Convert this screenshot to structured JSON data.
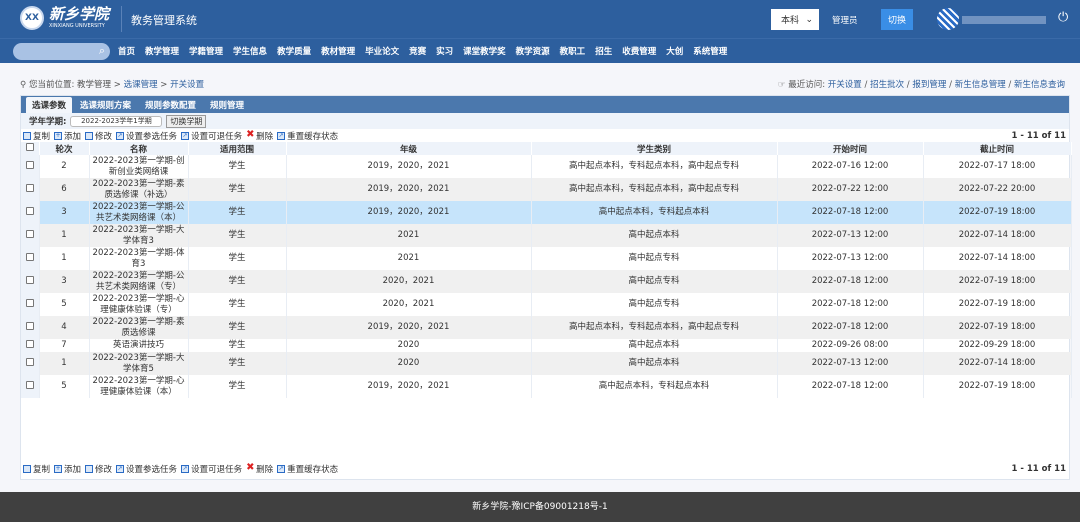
{
  "header": {
    "logo_cn": "新乡学院",
    "logo_en": "XINXIANG UNIVERSITY",
    "system_title": "教务管理系统",
    "level_select": "本科",
    "role": "管理员",
    "switch_button": "切换"
  },
  "nav": {
    "items": [
      "首页",
      "教学管理",
      "学籍管理",
      "学生信息",
      "教学质量",
      "教材管理",
      "毕业论文",
      "竞赛",
      "实习",
      "课堂教学奖",
      "教学资源",
      "教职工",
      "招生",
      "收费管理",
      "大创",
      "系统管理"
    ]
  },
  "breadcrumb": {
    "label": "您当前位置:",
    "items": [
      "教学管理",
      "选课管理",
      "开关设置"
    ]
  },
  "recent": {
    "label": "最近访问:",
    "items": [
      "开关设置",
      "招生批次",
      "报到管理",
      "新生信息管理",
      "新生信息查询"
    ]
  },
  "tabs": [
    "选课参数",
    "选课规则方案",
    "规则参数配置",
    "规则管理"
  ],
  "semester": {
    "label": "学年学期:",
    "value": "2022-2023学年1学期",
    "button": "切换学期"
  },
  "toolbar": {
    "copy": "复制",
    "add": "添加",
    "edit": "修改",
    "set_select": "设置参选任务",
    "set_drop": "设置可退任务",
    "delete": "删除",
    "reset": "重置缓存状态"
  },
  "pagination": "1 - 11 of 11",
  "table": {
    "headers": [
      "轮次",
      "名称",
      "适用范围",
      "年级",
      "学生类别",
      "开始时间",
      "截止时间"
    ],
    "rows": [
      [
        "2",
        "2022-2023第一学期-创新创业类网络课",
        "学生",
        "2019，2020，2021",
        "高中起点本科，专科起点本科，高中起点专科",
        "2022-07-16 12:00",
        "2022-07-17 18:00"
      ],
      [
        "6",
        "2022-2023第一学期-素质选修课（补选）",
        "学生",
        "2019，2020，2021",
        "高中起点本科，专科起点本科，高中起点专科",
        "2022-07-22 12:00",
        "2022-07-22 20:00"
      ],
      [
        "3",
        "2022-2023第一学期-公共艺术类网络课（本）",
        "学生",
        "2019，2020，2021",
        "高中起点本科，专科起点本科",
        "2022-07-18 12:00",
        "2022-07-19 18:00"
      ],
      [
        "1",
        "2022-2023第一学期-大学体育3",
        "学生",
        "2021",
        "高中起点本科",
        "2022-07-13 12:00",
        "2022-07-14 18:00"
      ],
      [
        "1",
        "2022-2023第一学期-体育3",
        "学生",
        "2021",
        "高中起点专科",
        "2022-07-13 12:00",
        "2022-07-14 18:00"
      ],
      [
        "3",
        "2022-2023第一学期-公共艺术类网络课（专）",
        "学生",
        "2020，2021",
        "高中起点专科",
        "2022-07-18 12:00",
        "2022-07-19 18:00"
      ],
      [
        "5",
        "2022-2023第一学期-心理健康体验课（专）",
        "学生",
        "2020，2021",
        "高中起点专科",
        "2022-07-18 12:00",
        "2022-07-19 18:00"
      ],
      [
        "4",
        "2022-2023第一学期-素质选修课",
        "学生",
        "2019，2020，2021",
        "高中起点本科，专科起点本科，高中起点专科",
        "2022-07-18 12:00",
        "2022-07-19 18:00"
      ],
      [
        "7",
        "英语演讲技巧",
        "学生",
        "2020",
        "高中起点本科",
        "2022-09-26 08:00",
        "2022-09-29 18:00"
      ],
      [
        "1",
        "2022-2023第一学期-大学体育5",
        "学生",
        "2020",
        "高中起点本科",
        "2022-07-13 12:00",
        "2022-07-14 18:00"
      ],
      [
        "5",
        "2022-2023第一学期-心理健康体验课（本）",
        "学生",
        "2019，2020，2021",
        "高中起点本科，专科起点本科",
        "2022-07-18 12:00",
        "2022-07-19 18:00"
      ]
    ],
    "selected_row": 2
  },
  "footer": "新乡学院-豫ICP备09001218号-1"
}
